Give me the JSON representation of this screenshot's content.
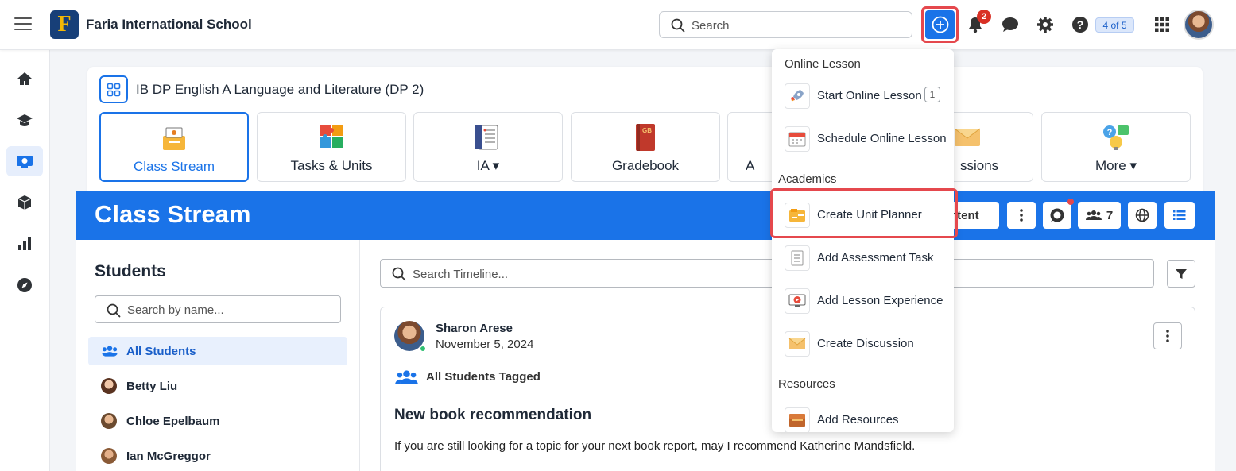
{
  "app": {
    "school_name": "Faria International School",
    "logo_letter": "F",
    "search_placeholder": "Search",
    "notifications_count": "2",
    "account_pill": "4 of 5",
    "accent_color": "#1a73e8"
  },
  "course": {
    "title": "IB DP English A Language and Literature (DP 2)",
    "tiles": [
      {
        "label": "Class Stream",
        "icon": "class-stream-icon"
      },
      {
        "label": "Tasks & Units",
        "icon": "puzzle-icon"
      },
      {
        "label": "IA ▾",
        "icon": "ia-icon"
      },
      {
        "label": "Gradebook",
        "icon": "gradebook-icon"
      },
      {
        "label": "A",
        "icon": "hidden-tile-icon"
      },
      {
        "label": "ssions",
        "icon": "discussions-icon"
      },
      {
        "label": "More ▾",
        "icon": "more-icon"
      }
    ]
  },
  "banner": {
    "title": "Class Stream",
    "content_btn": "ntent",
    "students_count": "7"
  },
  "students": {
    "title": "Students",
    "search_placeholder": "Search by name...",
    "items": [
      {
        "label": "All Students"
      },
      {
        "label": "Betty Liu"
      },
      {
        "label": "Chloe Epelbaum"
      },
      {
        "label": "Ian McGreggor"
      }
    ]
  },
  "timeline": {
    "search_placeholder": "Search Timeline...",
    "post": {
      "author": "Sharon Arese",
      "date": "November 5, 2024",
      "tagged": "All Students Tagged",
      "title": "New book recommendation",
      "body": "If you are still looking for a topic for your next book report, may I recommend Katherine Mandsfield."
    }
  },
  "dropdown": {
    "sections": [
      {
        "label": "Online Lesson"
      },
      {
        "label": "Academics"
      },
      {
        "label": "Resources"
      }
    ],
    "items": [
      {
        "label": "Start Online Lesson",
        "count": "1",
        "icon": "rocket-icon"
      },
      {
        "label": "Schedule Online Lesson",
        "icon": "calendar-icon"
      },
      {
        "label": "Create Unit Planner",
        "icon": "unit-planner-icon"
      },
      {
        "label": "Add Assessment Task",
        "icon": "assessment-icon"
      },
      {
        "label": "Add Lesson Experience",
        "icon": "lesson-experience-icon"
      },
      {
        "label": "Create Discussion",
        "icon": "envelope-icon"
      },
      {
        "label": "Add Resources",
        "icon": "resources-icon"
      }
    ]
  }
}
